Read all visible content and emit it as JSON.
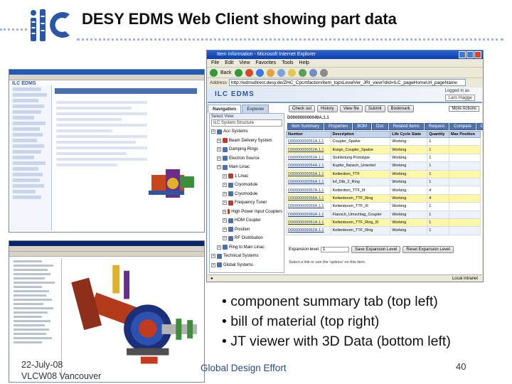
{
  "slide": {
    "title": "DESY EDMS Web Client showing part data",
    "bullets": [
      "• component summary tab (top left)",
      "• bill of material (top right)",
      "• JT viewer with 3D Data (bottom left)"
    ],
    "footer": {
      "date": "22-July-08",
      "conference": "VLCW08 Vancouver",
      "tagline": "Global Design Effort",
      "page_number": "40"
    }
  },
  "browser": {
    "window_title": "Item Information - Microsoft Internet Explorer",
    "menu": [
      "File",
      "Edit",
      "View",
      "Favorites",
      "Tools",
      "Help"
    ],
    "toolbar": {
      "back_label": "Back"
    },
    "address_label": "Address",
    "address_value": "http://edmsdirect.desy.de/ZHC_Cpcmfaction/item_topsLevelVer_JRI_view?dId=ILC_pageHomeUrl_pageName",
    "status_text": "Local intranet"
  },
  "app": {
    "brand": "ILC EDMS",
    "user_label": "Logged in as",
    "user_value": "Lars Hagge",
    "tabs": [
      "Navigation",
      "Explorer"
    ],
    "tree_header": "Select View:",
    "tree_select": "ILC System Structure",
    "tree": [
      {
        "label": "Acc Systems",
        "level": 0,
        "color": "#4a6fb0"
      },
      {
        "label": "Beam Delivery System",
        "level": 1,
        "color": "#c0392b"
      },
      {
        "label": "Damping Rings",
        "level": 1,
        "color": "#4a6fb0"
      },
      {
        "label": "Electron Source",
        "level": 1,
        "color": "#4a6fb0"
      },
      {
        "label": "Main Linac",
        "level": 1,
        "color": "#4a6fb0"
      },
      {
        "label": "1 Linac",
        "level": 2,
        "color": "#c0392b"
      },
      {
        "label": "Cryomodule",
        "level": 2,
        "color": "#4a6fb0"
      },
      {
        "label": "Cryomodule",
        "level": 2,
        "color": "#4a6fb0"
      },
      {
        "label": "Frequency Tuner",
        "level": 2,
        "color": "#c0392b"
      },
      {
        "label": "High Power Input Couplers",
        "level": 2,
        "color": "#c0392b"
      },
      {
        "label": "HOM Coupler",
        "level": 2,
        "color": "#4a6fb0"
      },
      {
        "label": "Position",
        "level": 2,
        "color": "#4a6fb0"
      },
      {
        "label": "RF Distribution",
        "level": 2,
        "color": "#4a6fb0"
      },
      {
        "label": "Ring to Main Linac",
        "level": 1,
        "color": "#4a6fb0"
      },
      {
        "label": "Technical Systems",
        "level": 0,
        "color": "#4a6fb0"
      },
      {
        "label": "Global Systems",
        "level": 0,
        "color": "#4a6fb0"
      }
    ],
    "actions": [
      "Check out",
      "History",
      "View file",
      "Submit",
      "Bookmark"
    ],
    "more_actions": "More Actions",
    "subtabs": [
      "Item Summary",
      "Properties",
      "BOM",
      "Doc",
      "Related Items",
      "Request",
      "Compare",
      "Class Position"
    ],
    "bom_columns": [
      "Number",
      "Description",
      "Life Cycle State",
      "Quantity",
      "Max Position"
    ],
    "bom_top": "D000000000049A.1.1",
    "bom_rows": [
      {
        "number": "D00000000051A.1.1",
        "description": "Coupler_Spalve",
        "state": "Working",
        "qty": "1"
      },
      {
        "number": "D00000000052A.1.1",
        "description": "Eisign_Coupler_Spalve",
        "state": "Working",
        "qty": "1"
      },
      {
        "number": "D00000000053A.1.1",
        "description": "Stuhleitung Prototype",
        "state": "Working",
        "qty": "1"
      },
      {
        "number": "D00000000054A.1.1",
        "description": "Kupfer_flansch_Unterteil",
        "state": "Working",
        "qty": "1"
      },
      {
        "number": "D00000000055A.1.1",
        "description": "Ketlerdom_TTF",
        "state": "Working",
        "qty": "1"
      },
      {
        "number": "D00000000056A.1.1",
        "description": "Inf_Dtb_2_Ring",
        "state": "Working",
        "qty": "1"
      },
      {
        "number": "D00000000057A.1.1",
        "description": "Ketlerdom_TTF_III",
        "state": "Working",
        "qty": "4"
      },
      {
        "number": "D00000000058A.1.1",
        "description": "Keltenboom_TTF_Ring",
        "state": "Working",
        "qty": "4"
      },
      {
        "number": "D00000000059A.1.1",
        "description": "Keltenboom_TTF_III",
        "state": "Working",
        "qty": "1"
      },
      {
        "number": "D00000000060A.1.1",
        "description": "Flansch_Umschlag_Coupler",
        "state": "Working",
        "qty": "1"
      },
      {
        "number": "D00000000061A.1.1",
        "description": "Keltenboom_TTF_Ring_III",
        "state": "Working",
        "qty": "1"
      },
      {
        "number": "D00000000062A.1.1",
        "description": "Keltenboom_TTF_Ring",
        "state": "Working",
        "qty": "1"
      }
    ],
    "expansion_label": "Expansion level",
    "expansion_value": "1",
    "save_expansion": "Save Expansion Level",
    "reset_expansion": "Reset Expansion Level",
    "hint": "Select a link or use the 'options' on this item."
  },
  "thumbnails": {
    "summary_brand": "ILC EDMS"
  },
  "colors": {
    "accent_blue": "#2c56a0",
    "selected_row": "#fff7a8",
    "header_row": "#c6d4ea",
    "footer_blue": "#2a4a8a"
  }
}
